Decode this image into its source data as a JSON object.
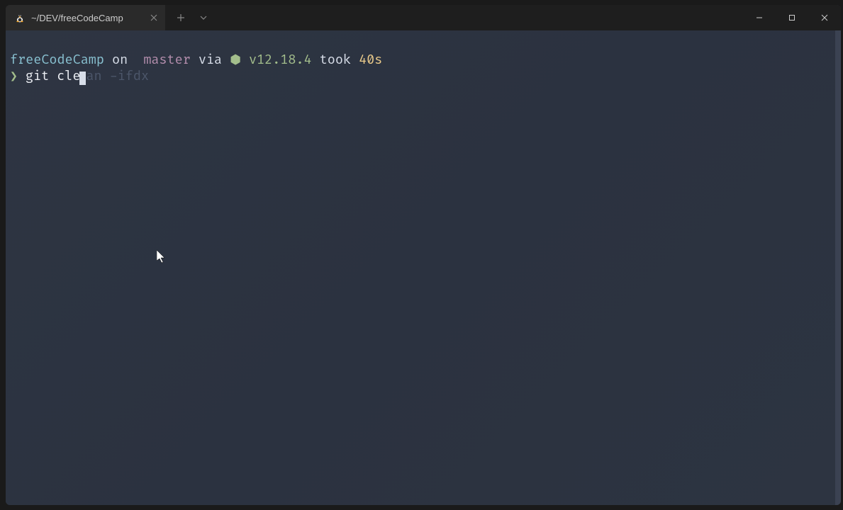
{
  "tab": {
    "title": "~/DEV/freeCodeCamp"
  },
  "prompt": {
    "directory": "freeCodeCamp",
    "on_label": " on ",
    "branch_icon": "",
    "branch": " master",
    "via_label": " via ",
    "node_icon": "⬢",
    "version": " v12.18.4",
    "took_label": " took ",
    "duration": "40s",
    "arrow": "❯",
    "command_typed": " git cle",
    "command_suggestion": "an -ifdx"
  }
}
